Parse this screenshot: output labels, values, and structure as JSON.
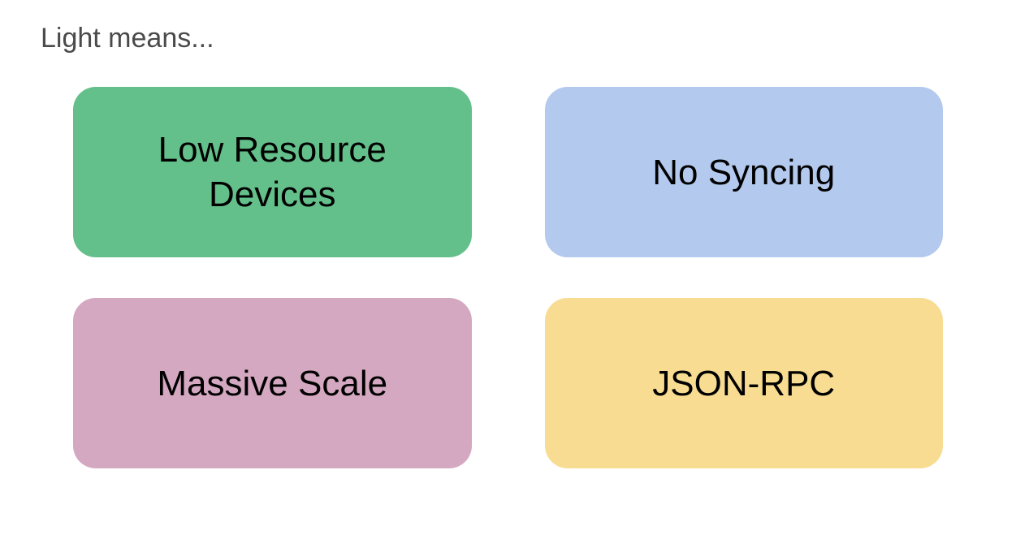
{
  "title": "Light means...",
  "cards": [
    {
      "label": "Low Resource Devices",
      "color": "#64c08a"
    },
    {
      "label": "No Syncing",
      "color": "#b3c9ed"
    },
    {
      "label": "Massive Scale",
      "color": "#d4a8c0"
    },
    {
      "label": "JSON-RPC",
      "color": "#f7dc92"
    }
  ]
}
